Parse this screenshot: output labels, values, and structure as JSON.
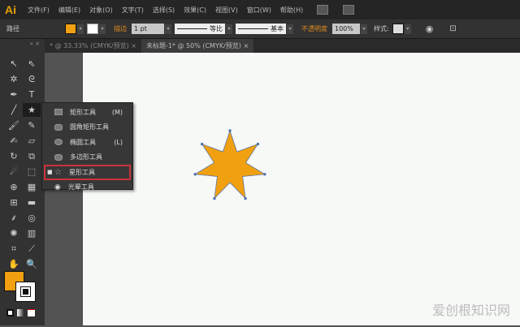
{
  "app": {
    "logo": "Ai"
  },
  "menu": [
    "文件(F)",
    "编辑(E)",
    "对象(O)",
    "文字(T)",
    "选择(S)",
    "效果(C)",
    "视图(V)",
    "窗口(W)",
    "帮助(H)"
  ],
  "control": {
    "object_type": "路径",
    "stroke_label": "描边",
    "stroke_weight": "1 pt",
    "profile": "等比",
    "brush": "基本",
    "opacity_label": "不透明度",
    "opacity": "100%",
    "style_label": "样式:"
  },
  "tabs": [
    {
      "label": "* @ 33.33% (CMYK/预览)",
      "close": "×"
    },
    {
      "label": "未标题-1* @ 50% (CMYK/预览)",
      "close": "×"
    }
  ],
  "flyout": [
    {
      "label": "矩形工具",
      "key": "(M)"
    },
    {
      "label": "圆角矩形工具",
      "key": ""
    },
    {
      "label": "椭圆工具",
      "key": "(L)"
    },
    {
      "label": "多边形工具",
      "key": ""
    },
    {
      "label": "星形工具",
      "key": "",
      "selected": true
    },
    {
      "label": "光晕工具",
      "key": ""
    }
  ],
  "colors": {
    "fill": "#f0a010",
    "accent": "#c8333a"
  },
  "watermark": "爱创根知识网"
}
